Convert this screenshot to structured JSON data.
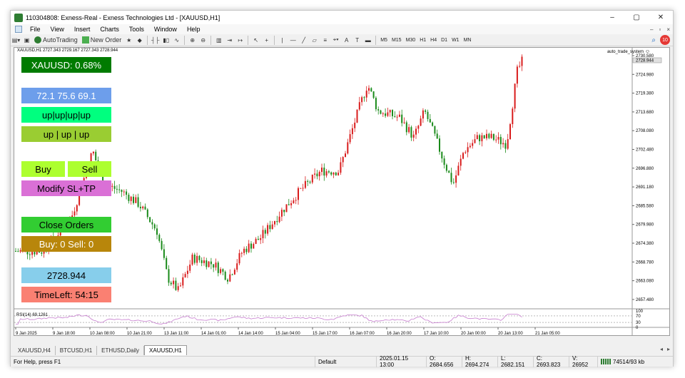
{
  "window": {
    "title": "110304808: Exness-Real - Exness Technologies Ltd - [XAUUSD,H1]",
    "controls": [
      "–",
      "▢",
      "✕"
    ]
  },
  "menu": {
    "items": [
      "File",
      "View",
      "Insert",
      "Charts",
      "Tools",
      "Window",
      "Help"
    ],
    "mdi_controls": [
      "–",
      "▫",
      "×"
    ]
  },
  "toolbar": {
    "autotrading_label": "AutoTrading",
    "new_order_label": "New Order",
    "timeframes": [
      "M5",
      "M15",
      "M30",
      "H1",
      "H4",
      "D1",
      "W1",
      "MN"
    ],
    "notifications": "10"
  },
  "chart": {
    "header": "XAUUSD,H1  2727.343 2729.167 2727.343 2728.944",
    "ea_name": "auto_trade_system",
    "current_price": "2728.944",
    "price_axis": [
      "2730.580",
      "2724.980",
      "2719.380",
      "2713.680",
      "2708.080",
      "2702.480",
      "2696.880",
      "2691.180",
      "2685.580",
      "2679.980",
      "2674.380",
      "2668.780",
      "2663.080",
      "2657.480"
    ],
    "time_axis": [
      "9 Jan 2025",
      "9 Jan 18:00",
      "10 Jan 08:00",
      "10 Jan 21:00",
      "13 Jan 11:00",
      "14 Jan 01:00",
      "14 Jan 14:00",
      "15 Jan 04:00",
      "15 Jan 17:00",
      "16 Jan 07:00",
      "16 Jan 20:00",
      "17 Jan 10:00",
      "20 Jan 00:00",
      "20 Jan 13:00",
      "21 Jan 05:00"
    ],
    "rsi_label": "RSI(14) 69.1261",
    "rsi_axis": [
      "100",
      "70",
      "30",
      "0"
    ],
    "up_color": "#d91c1c",
    "down_color": "#1a8a1a",
    "rsi_color": "#c77dcf"
  },
  "panel": {
    "symbol": "XAUUSD: 0.68%",
    "rsi_values": "72.1  75.6  69.1",
    "trend1": "up|up|up|up",
    "trend2": "up | up | up",
    "buy": "Buy",
    "sell": "Sell",
    "modify": "Modify SL+TP",
    "close_orders": "Close Orders",
    "order_counts": "Buy: 0  Sell: 0",
    "price": "2728.944",
    "timeleft": "TimeLeft: 54:15"
  },
  "tabs": [
    "XAUUSD,H4",
    "BTCUSD,H1",
    "ETHUSD,Daily",
    "XAUUSD,H1"
  ],
  "status": {
    "help": "For Help, press F1",
    "profile": "Default",
    "time": "2025.01.15 13:00",
    "open": "O: 2684.656",
    "high": "H: 2694.274",
    "low": "L: 2682.151",
    "close": "C: 2693.823",
    "volume": "V: 26952",
    "traffic": "74514/93 kb"
  }
}
